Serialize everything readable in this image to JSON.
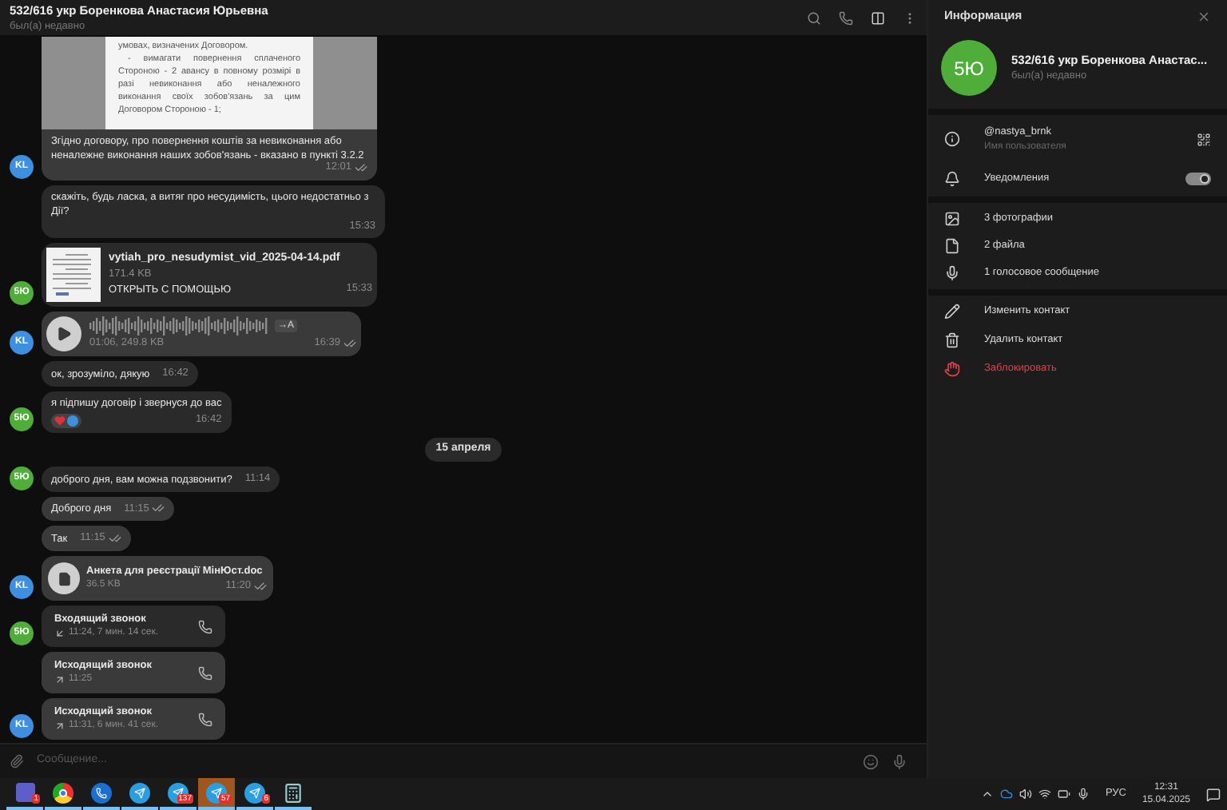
{
  "chat": {
    "title": "532/616 укр Боренкова Анастасия Юрьевна",
    "status": "был(а) недавно"
  },
  "groups": [
    {
      "kind": "group",
      "avatar": {
        "initials": "KL",
        "color": "#3f8fe0"
      },
      "messages": [
        {
          "outgoing": true,
          "read": true,
          "document_text": [
            "умовах, визначених Договором.",
            "- вимагати повернення сплаченого Стороною - 2 авансу в повному розмірі в разі невиконання або неналежного виконання своїх зобов'язань за цим Договором Стороною - 1;"
          ],
          "text": "Згідно договору, про повернення коштів за невиконання або неналежне виконання наших зобов'язань - вказано в пункті 3.2.2",
          "time": "12:01"
        }
      ]
    },
    {
      "kind": "group",
      "avatar": {
        "initials": "5Ю",
        "color": "#4fae3a"
      },
      "messages": [
        {
          "kind": "text",
          "outgoing": false,
          "text": "скажіть, будь ласка, а витяг про несудимість, цього недостатньо з Дії?",
          "time": "15:33"
        },
        {
          "kind": "file",
          "outgoing": false,
          "name": "vytiah_pro_nesudymist_vid_2025-04-14.pdf",
          "size": "171.4 KB",
          "action": "ОТКРЫТЬ С ПОМОЩЬЮ",
          "time": "15:33"
        }
      ]
    },
    {
      "kind": "group",
      "avatar": {
        "initials": "KL",
        "color": "#3f8fe0"
      },
      "messages": [
        {
          "kind": "voice",
          "outgoing": true,
          "read": true,
          "info": "01:06, 249.8 KB",
          "transcribe": "→A",
          "time": "16:39"
        }
      ]
    },
    {
      "kind": "group",
      "avatar": {
        "initials": "5Ю",
        "color": "#4fae3a"
      },
      "messages": [
        {
          "kind": "text",
          "outgoing": false,
          "text": "ок, зрозуміло, дякую",
          "time": "16:42"
        },
        {
          "kind": "text",
          "outgoing": false,
          "text": "я підпишу договір і звернуся до вас",
          "time": "16:42",
          "reactions": [
            {
              "kind": "heart"
            },
            {
              "kind": "avatar"
            }
          ]
        }
      ]
    },
    {
      "kind": "date",
      "text": "15 апреля"
    },
    {
      "kind": "group",
      "avatar": {
        "initials": "5Ю",
        "color": "#4fae3a"
      },
      "messages": [
        {
          "kind": "text",
          "outgoing": false,
          "text": "доброго дня, вам можна подзвонити?",
          "time": "11:14"
        }
      ]
    },
    {
      "kind": "group",
      "avatar": {
        "initials": "KL",
        "color": "#3f8fe0"
      },
      "messages": [
        {
          "kind": "text",
          "outgoing": true,
          "read": true,
          "text": "Доброго дня",
          "time": "11:15"
        },
        {
          "kind": "text",
          "outgoing": true,
          "read": true,
          "text": "Так",
          "time": "11:15"
        },
        {
          "kind": "doc",
          "outgoing": true,
          "read": true,
          "name": "Анкета для реєстрації МінЮст.doc",
          "size": "36.5 KB",
          "time": "11:20"
        }
      ]
    },
    {
      "kind": "group",
      "avatar": {
        "initials": "5Ю",
        "color": "#4fae3a"
      },
      "messages": [
        {
          "kind": "call",
          "outgoing": false,
          "incoming": true,
          "title": "Входящий звонок",
          "detail": "11:24, 7 мин. 14 сек."
        }
      ]
    },
    {
      "kind": "group",
      "avatar": {
        "initials": "KL",
        "color": "#3f8fe0"
      },
      "messages": [
        {
          "kind": "call",
          "outgoing": true,
          "incoming": false,
          "title": "Исходящий звонок",
          "detail": "11:25"
        },
        {
          "kind": "call",
          "outgoing": true,
          "incoming": false,
          "title": "Исходящий звонок",
          "detail": "11:31, 6 мин. 41 сек."
        }
      ]
    }
  ],
  "composer": {
    "placeholder": "Сообщение..."
  },
  "info": {
    "title": "Информация",
    "avatar": {
      "initials": "5Ю",
      "color": "#4fae3a"
    },
    "name": "532/616 укр Боренкова Анастас...",
    "status": "был(а) недавно",
    "username": "@nastya_brnk",
    "username_label": "Имя пользователя",
    "notifications": {
      "label": "Уведомления",
      "on": true
    },
    "media": [
      {
        "kind": "photos",
        "label": "3 фотографии"
      },
      {
        "kind": "files",
        "label": "2 файла"
      },
      {
        "kind": "voice",
        "label": "1 голосовое сообщение"
      }
    ],
    "actions": [
      {
        "kind": "edit",
        "label": "Изменить контакт",
        "danger": false
      },
      {
        "kind": "delete",
        "label": "Удалить контакт",
        "danger": false
      },
      {
        "kind": "block",
        "label": "Заблокировать",
        "danger": true
      }
    ]
  },
  "taskbar": {
    "apps": [
      {
        "kind": "teams",
        "badge": "1",
        "active": false
      },
      {
        "kind": "chrome",
        "active": false
      },
      {
        "kind": "phone",
        "active": false
      },
      {
        "kind": "telegram",
        "active": false
      },
      {
        "kind": "telegram",
        "badge": "137",
        "active": false
      },
      {
        "kind": "telegram",
        "badge": "57",
        "active": true
      },
      {
        "kind": "telegram",
        "badge": "6",
        "active": false
      },
      {
        "kind": "calculator",
        "active": false
      }
    ],
    "language": "РУС",
    "time": "12:31",
    "date": "15.04.2025"
  }
}
